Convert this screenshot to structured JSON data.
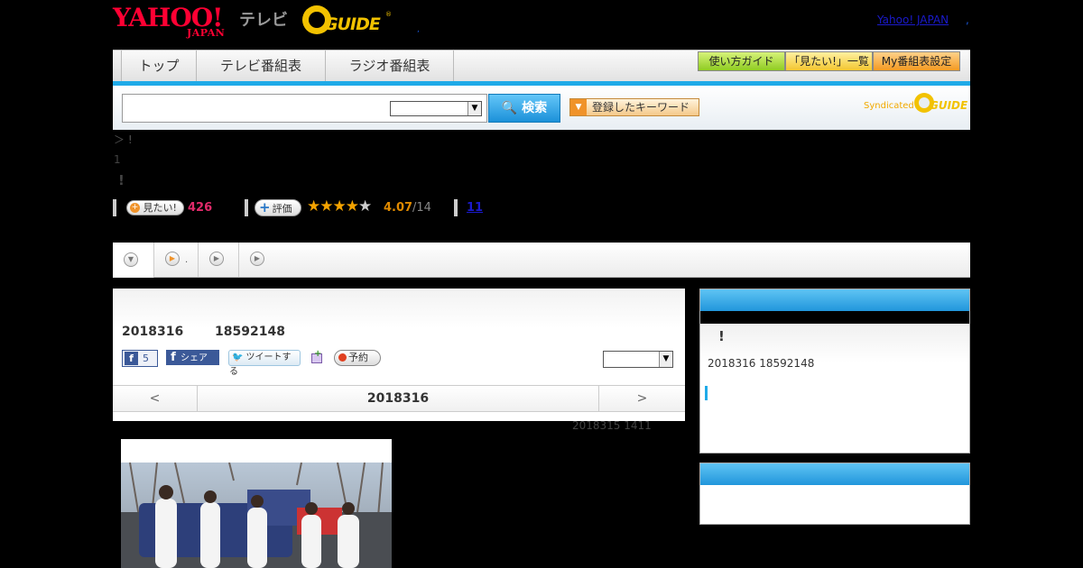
{
  "header": {
    "brand_yahoo": "YAHOO!",
    "brand_japan": "JAPAN",
    "brand_tv": "テレビ",
    "brand_gguide": "GUIDE",
    "brand_gguide_mark": "®",
    "dot": ",",
    "yahoo_japan_link": "Yahoo! JAPAN",
    "dot2": ","
  },
  "nav": {
    "tabs": [
      {
        "label": "トップ"
      },
      {
        "label": "テレビ番組表"
      },
      {
        "label": "ラジオ番組表"
      }
    ],
    "sub_buttons": [
      {
        "label": "使い方ガイド"
      },
      {
        "label": "「見たい!」一覧"
      },
      {
        "label": "My番組表設定"
      }
    ],
    "accent_color": "#1faae8"
  },
  "search": {
    "value": "",
    "select_value": "",
    "button_label": "検索",
    "keyword_button_label": "登録したキーワード",
    "syndicated_label": "Syndicated",
    "syndicated_brand": "GUIDE"
  },
  "program": {
    "breadcrumb": "＞ !",
    "episode_number": "1",
    "title": "!",
    "mitai_label": "見たい!",
    "mitai_count": "426",
    "hyoka_label": "評価",
    "rating_stars_filled": 4,
    "rating_stars_total": 5,
    "rating": "4.07",
    "rating_count": "/14",
    "review_count": "11"
  },
  "tabs_row": {
    "dot_label": "."
  },
  "main": {
    "air_date": "2018316",
    "air_time": "18592148",
    "fb_like_count": "5",
    "fb_share_label": "シェア",
    "tweet_label": "ツイートする",
    "yoyaku_label": "予約",
    "panel_select_value": "",
    "date_prev": "<",
    "date_current": "2018316",
    "date_next": ">",
    "update_info": "2018315  1411"
  },
  "side": {
    "title": "!",
    "datetime": "2018316  18592148"
  }
}
